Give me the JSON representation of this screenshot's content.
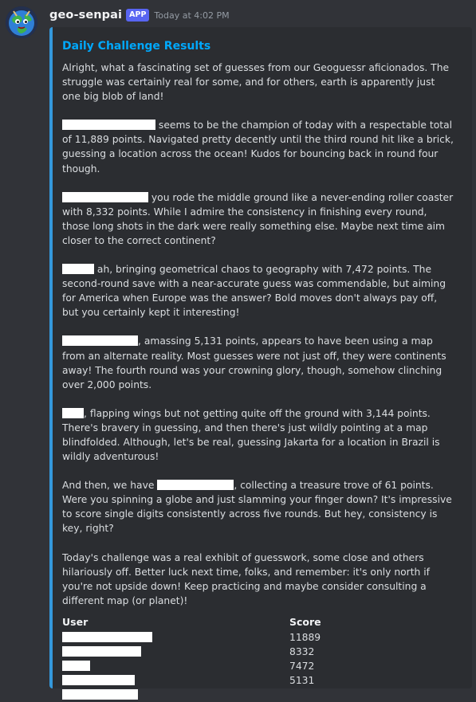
{
  "message": {
    "username": "geo-senpai",
    "app_tag": "APP",
    "timestamp": "Today at 4:02 PM",
    "accent_color": "#3498db"
  },
  "embed": {
    "title": "Daily Challenge Results",
    "intro": "Alright, what a fascinating set of guesses from our Geoguessr aficionados. The struggle was certainly real for some, and for others, earth is apparently just one big blob of land!",
    "p1_text": " seems to be the champion of today with a respectable total of 11,889 points. Navigated pretty decently until the third round hit like a brick, guessing a location across the ocean! Kudos for bouncing back in round four though.",
    "p2_text": " you rode the middle ground like a never-ending roller coaster with 8,332 points. While I admire the consistency in finishing every round, those long shots in the dark were really something else. Maybe next time aim closer to the correct continent?",
    "p3_text": " ah, bringing geometrical chaos to geography with 7,472 points. The second-round save with a near-accurate guess was commendable, but aiming for America when Europe was the answer? Bold moves don't always pay off, but you certainly kept it interesting!",
    "p4_text": ", amassing 5,131 points, appears to have been using a map from an alternate reality. Most guesses were not just off, they were continents away! The fourth round was your crowning glory, though, somehow clinching over 2,000 points.",
    "p5_text": ", flapping wings but not getting quite off the ground with 3,144 points. There's bravery in guessing, and then there's just wildly pointing at a map blindfolded. Although, let's be real, guessing Jakarta for a location in Brazil is wildly adventurous!",
    "p6_before": "And then, we have ",
    "p6_after": ", collecting a treasure trove of 61 points. Were you spinning a globe and just slamming your finger down? It's impressive to score single digits consistently across five rounds. But hey, consistency is key, right?",
    "outro": "Today's challenge was a real exhibit of guesswork, some close and others hilariously off. Better luck next time, folks, and remember: it's only north if you're not upside down! Keep practicing and maybe consider consulting a different map (or planet)!",
    "fields": {
      "user_header": "User",
      "score_header": "Score",
      "rows": [
        {
          "score": "11889"
        },
        {
          "score": "8332"
        },
        {
          "score": "7472"
        },
        {
          "score": "5131"
        },
        {
          "score": ""
        }
      ]
    }
  }
}
